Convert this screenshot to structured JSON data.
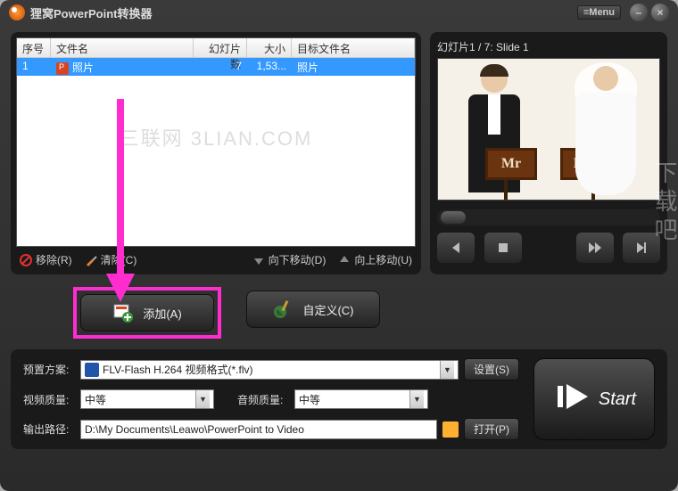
{
  "app_title": "狸窝PowerPoint转换器",
  "menu_label": "≡Menu",
  "table": {
    "headers": {
      "seq": "序号",
      "name": "文件名",
      "slides": "幻灯片数",
      "size": "大小",
      "target": "目标文件名"
    },
    "row": {
      "seq": "1",
      "name": "照片",
      "slides": "7",
      "size": "1,53...",
      "target": "照片"
    }
  },
  "watermark": "三联网 3LIAN.COM",
  "side_watermark": "下载吧",
  "toolbar": {
    "remove": "移除(R)",
    "clear": "清除(C)",
    "movedown": "向下移动(D)",
    "moveup": "向上移动(U)"
  },
  "preview": {
    "title": "幻灯片1 / 7: Slide 1",
    "sign_left": "Mr",
    "sign_right": "Mrs"
  },
  "actions": {
    "add": "添加(A)",
    "custom": "自定义(C)"
  },
  "settings": {
    "profile_label": "预置方案:",
    "profile_value": "FLV-Flash H.264 视频格式(*.flv)",
    "settings_btn": "设置(S)",
    "video_q_label": "视频质量:",
    "video_q_value": "中等",
    "audio_q_label": "音频质量:",
    "audio_q_value": "中等",
    "output_label": "输出路径:",
    "output_value": "D:\\My Documents\\Leawo\\PowerPoint to Video",
    "open_btn": "打开(P)"
  },
  "start_label": "Start"
}
